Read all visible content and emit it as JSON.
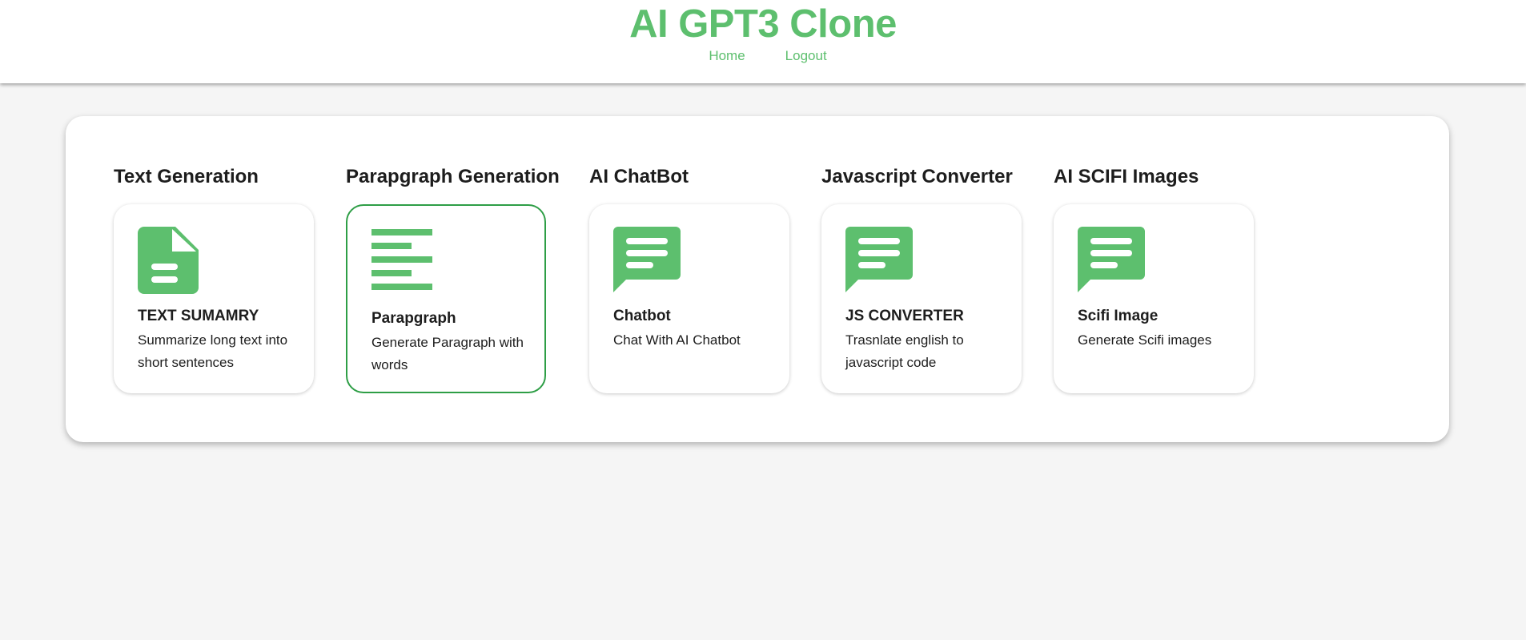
{
  "header": {
    "title": "AI GPT3 Clone",
    "nav": [
      {
        "label": "Home"
      },
      {
        "label": "Logout"
      }
    ]
  },
  "colors": {
    "brand": "#5dbf6e",
    "active_border": "#2e9e46"
  },
  "sections": [
    {
      "heading": "Text Generation",
      "card": {
        "icon": "document-icon",
        "title": "TEXT SUMAMRY",
        "description": "Summarize long text into short sentences",
        "selected": false
      }
    },
    {
      "heading": "Parapgraph Generation",
      "card": {
        "icon": "align-left-icon",
        "title": "Parapgraph",
        "description": "Generate Paragraph with words",
        "selected": true
      }
    },
    {
      "heading": "AI ChatBot",
      "card": {
        "icon": "chat-bubble-icon",
        "title": "Chatbot",
        "description": "Chat With AI Chatbot",
        "selected": false
      }
    },
    {
      "heading": "Javascript Converter",
      "card": {
        "icon": "chat-bubble-icon",
        "title": "JS CONVERTER",
        "description": "Trasnlate english to javascript code",
        "selected": false
      }
    },
    {
      "heading": "AI SCIFI Images",
      "card": {
        "icon": "chat-bubble-icon",
        "title": "Scifi Image",
        "description": "Generate Scifi images",
        "selected": false
      }
    }
  ]
}
